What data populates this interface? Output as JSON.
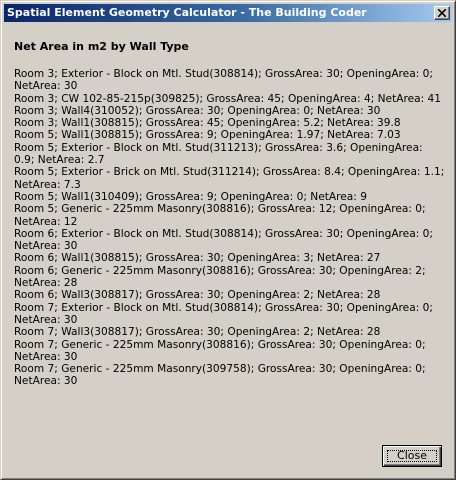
{
  "window": {
    "title": "Spatial Element Geometry Calculator - The Building Coder"
  },
  "content": {
    "heading": "Net Area in m2 by Wall Type",
    "lines": [
      "Room 3; Exterior - Block on Mtl. Stud(308814); GrossArea: 30; OpeningArea: 0; NetArea: 30",
      "Room 3; CW 102-85-215p(309825); GrossArea: 45; OpeningArea: 4; NetArea: 41",
      "Room 3; Wall4(310052); GrossArea: 30; OpeningArea: 0; NetArea: 30",
      "Room 3; Wall1(308815); GrossArea: 45; OpeningArea: 5.2; NetArea: 39.8",
      "Room 5; Wall1(308815); GrossArea: 9; OpeningArea: 1.97; NetArea: 7.03",
      "Room 5; Exterior - Block on Mtl. Stud(311213); GrossArea: 3.6; OpeningArea: 0.9; NetArea: 2.7",
      "Room 5; Exterior - Brick on Mtl. Stud(311214); GrossArea: 8.4; OpeningArea: 1.1; NetArea: 7.3",
      "Room 5; Wall1(310409); GrossArea: 9; OpeningArea: 0; NetArea: 9",
      "Room 5; Generic - 225mm Masonry(308816); GrossArea: 12; OpeningArea: 0; NetArea: 12",
      "Room 6; Exterior - Block on Mtl. Stud(308814); GrossArea: 30; OpeningArea: 0; NetArea: 30",
      "Room 6; Wall1(308815); GrossArea: 30; OpeningArea: 3; NetArea: 27",
      "Room 6; Generic - 225mm Masonry(308816); GrossArea: 30; OpeningArea: 2; NetArea: 28",
      "Room 6; Wall3(308817); GrossArea: 30; OpeningArea: 2; NetArea: 28",
      "Room 7; Exterior - Block on Mtl. Stud(308814); GrossArea: 30; OpeningArea: 0; NetArea: 30",
      "Room 7; Wall3(308817); GrossArea: 30; OpeningArea: 2; NetArea: 28",
      "Room 7; Generic - 225mm Masonry(308816); GrossArea: 30; OpeningArea: 0; NetArea: 30",
      "Room 7; Generic - 225mm Masonry(309758); GrossArea: 30; OpeningArea: 0; NetArea: 30"
    ]
  },
  "buttons": {
    "close_label": "Close"
  },
  "icons": {
    "title_close": "close-icon"
  },
  "colors": {
    "title_gradient_start": "#0a246a",
    "title_gradient_end": "#a6caf0",
    "window_face": "#d4d0c8"
  }
}
